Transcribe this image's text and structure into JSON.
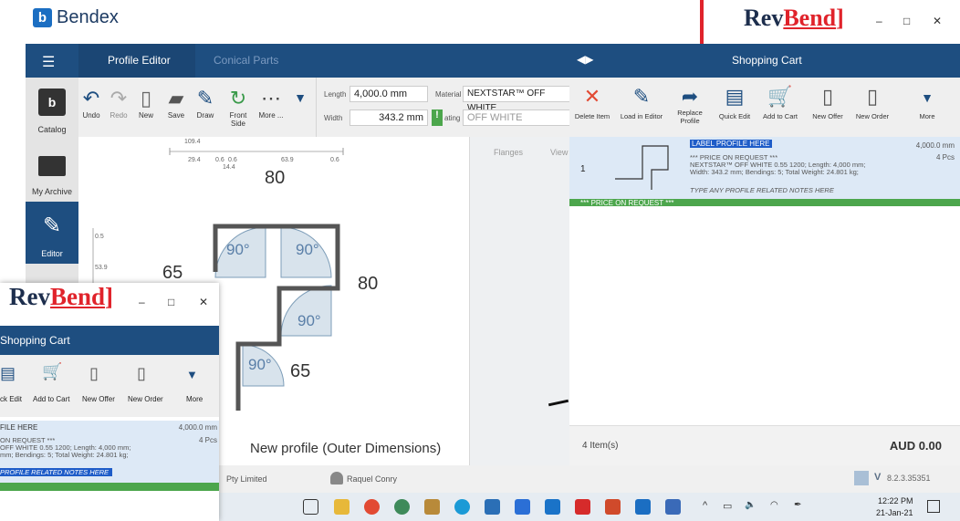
{
  "app": {
    "brand": "Bendex",
    "revbend_rev": "Rev",
    "revbend_bend": "Bend"
  },
  "nav": {
    "tab_profile_editor": "Profile Editor",
    "tab_conical_parts": "Conical Parts",
    "cart_title": "Shopping Cart"
  },
  "sidebar": {
    "catalog": "Catalog",
    "my_archive": "My Archive",
    "editor": "Editor"
  },
  "toolbar": {
    "undo": "Undo",
    "redo": "Redo",
    "new": "New",
    "save": "Save",
    "draw": "Draw",
    "front_side": "Front Side",
    "more": "More ..."
  },
  "fields": {
    "length_label": "Length",
    "length_value": "4,000.0 mm",
    "material_label": "Material",
    "material_value": "NEXTSTAR™ OFF WHITE",
    "width_label": "Width",
    "width_value": "343.2 mm",
    "coating_label": "ating",
    "coating_value": "OFF WHITE"
  },
  "ruler": {
    "top_total": "109.4",
    "seg1": "29.4",
    "seg2": "0.6",
    "seg3": "0.6",
    "seg4": "63.9",
    "seg5": "0.6",
    "sub": "14.4",
    "left1": "0.5",
    "left2": "53.9"
  },
  "profile": {
    "dim_top": "80",
    "dim_right": "80",
    "dim_left": "65",
    "dim_bottom": "65",
    "angle1": "90°",
    "angle2": "90°",
    "angle3": "90°",
    "angle4": "90°",
    "caption": "New profile (Outer Dimensions)"
  },
  "sidepanel": {
    "flanges": "Flanges",
    "view": "View"
  },
  "status": {
    "company": "Pty Limited",
    "user": "Raquel Conry",
    "version": "8.2.3.35351"
  },
  "cart": {
    "buttons": {
      "delete_item": "Delete Item",
      "load_in_editor": "Load in Editor",
      "replace_profile": "Replace Profile",
      "quick_edit": "Quick Edit",
      "add_to_cart": "Add to Cart",
      "new_offer": "New Offer",
      "new_order": "New Order",
      "more": "More"
    },
    "item": {
      "index": "1",
      "label": "LABEL PROFILE HERE",
      "price_note": "*** PRICE ON REQUEST ***",
      "desc1": "NEXTSTAR™ OFF WHITE 0.55 1200; Length: 4,000 mm;",
      "desc2": "Width: 343.2 mm; Bendings: 5; Total Weight: 24.801 kg;",
      "notes": "TYPE ANY PROFILE RELATED NOTES HERE",
      "length": "4,000.0 mm",
      "qty": "4 Pcs",
      "green_bar": "*** PRICE ON REQUEST ***"
    },
    "footer": {
      "count": "4 Item(s)",
      "total": "AUD 0.00"
    }
  },
  "float": {
    "title": "Shopping Cart",
    "quick_edit": "ck Edit",
    "add_to_cart": "Add to Cart",
    "new_offer": "New Offer",
    "new_order": "New Order",
    "more": "More",
    "label": "FILE HERE",
    "length": "4,000.0 mm",
    "price_note": "ON REQUEST ***",
    "qty": "4 Pcs",
    "desc1": "OFF WHITE 0.55 1200; Length: 4,000 mm;",
    "desc2": "mm; Bendings: 5; Total Weight: 24.801 kg;",
    "notes": "PROFILE RELATED NOTES HERE"
  },
  "taskbar": {
    "time": "12:22 PM",
    "date": "21-Jan-21"
  },
  "colors": {
    "nav_blue": "#1e4e80",
    "accent_red": "#e0232b",
    "green": "#4ca64c",
    "item_bg": "#dde9f6"
  }
}
